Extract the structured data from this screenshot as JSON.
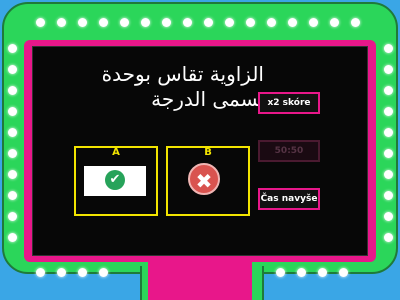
{
  "question": {
    "text": "الزاوية تقاس بوحدة تسمى الدرجة"
  },
  "answers": [
    {
      "letter": "A",
      "mark": "✔",
      "icon": "check-icon"
    },
    {
      "letter": "B",
      "mark": "✖",
      "icon": "x-icon"
    }
  ],
  "powerups": {
    "double_score": "x2 skóre",
    "fifty_fifty": "50:50",
    "more_time": "Čas navyše"
  },
  "colors": {
    "frame_green": "#2bd65a",
    "frame_pink": "#e8178a",
    "answer_border": "#f2e400",
    "background": "#3aa6e6"
  }
}
